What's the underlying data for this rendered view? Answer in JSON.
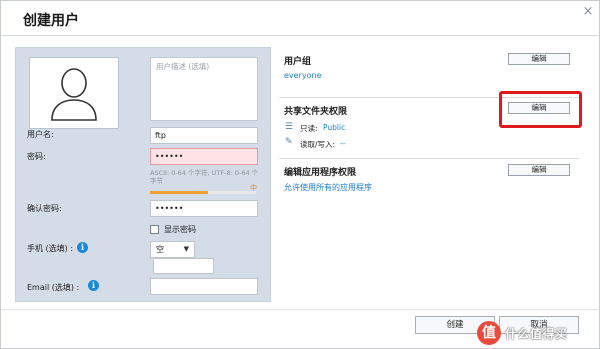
{
  "dialog": {
    "title": "创建用户",
    "close_symbol": "×"
  },
  "left": {
    "description_placeholder": "用户描述 (选填)",
    "username_label": "用户名:",
    "username_value": "ftp",
    "password_label": "密码:",
    "password_value": "••••••",
    "password_hint": "ASCII: 0-64 个字符, UTF-8: 0-64 个字节",
    "strength_label": "中",
    "strength_percent": 55,
    "confirm_label": "确认密码:",
    "confirm_value": "••••••",
    "show_password_label": "显示密码",
    "show_password_checked": false,
    "phone_label": "手机 (选填) :",
    "phone_country_value": "空",
    "phone_number_value": "",
    "email_label": "Email (选填) :",
    "email_value": "",
    "info_icon_glyph": "i"
  },
  "right": {
    "user_group": {
      "title": "用户组",
      "edit_label": "编辑",
      "value": "everyone"
    },
    "shared_folders": {
      "title": "共享文件夹权限",
      "edit_label": "编辑",
      "read_only_label": "只读:",
      "read_only_value": "Public",
      "read_write_label": "读取/写入:",
      "read_write_value": "--"
    },
    "app_permissions": {
      "title": "编辑应用程序权限",
      "edit_label": "编辑",
      "value": "允许使用所有的应用程序"
    }
  },
  "footer": {
    "create_label": "创建",
    "cancel_label": "取消"
  },
  "watermark": {
    "icon": "值",
    "text": "什么值得买"
  },
  "colors": {
    "panel_bg": "#d4dde7",
    "link": "#1c7cd0",
    "highlight": "#e0191f",
    "strength": "#f0a030",
    "password_error_bg": "#fde3e6"
  }
}
